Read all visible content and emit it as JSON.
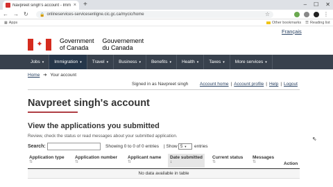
{
  "browser": {
    "tab_title": "Navpreet singh's account - Imm",
    "tab_close": "×",
    "new_tab": "+",
    "url": "onlineservices-servicesenligne.cic.gc.ca/mycic/home",
    "bookmarks": {
      "apps": "Apps",
      "other": "Other bookmarks",
      "reading": "Reading list"
    }
  },
  "header": {
    "language_link": "Français",
    "sig_en_1": "Government",
    "sig_en_2": "of Canada",
    "sig_fr_1": "Gouvernement",
    "sig_fr_2": "du Canada",
    "flag_leaf": "✦"
  },
  "menu": {
    "items": [
      {
        "label": "Jobs"
      },
      {
        "label": "Immigration"
      },
      {
        "label": "Travel"
      },
      {
        "label": "Business"
      },
      {
        "label": "Benefits"
      },
      {
        "label": "Health"
      },
      {
        "label": "Taxes"
      },
      {
        "label": "More services"
      }
    ],
    "caret": "▾",
    "active_index": 1
  },
  "breadcrumb": {
    "home": "Home",
    "arrow": "➔",
    "current": "Your account"
  },
  "account_bar": {
    "signed_in": "Signed in as Navpreet singh",
    "links": [
      "Account home",
      "Account profile",
      "Help",
      "Logout"
    ],
    "separator": "|"
  },
  "main": {
    "title": "Navpreet singh's account",
    "section_title": "View the applications you submitted",
    "description": "Review, check the status or read messages about your submitted application."
  },
  "table_controls": {
    "search_label": "Search:",
    "showing": "Showing 0 to 0 of 0 entries",
    "show": "| Show",
    "entries_value": "5",
    "entries_label": "entries"
  },
  "table": {
    "columns": [
      "Application type",
      "Application number",
      "Applicant name",
      "Date submitted",
      "Current status",
      "Messages",
      "Action"
    ],
    "sorted_column": "Date submitted",
    "empty_text": "No data available in table"
  }
}
